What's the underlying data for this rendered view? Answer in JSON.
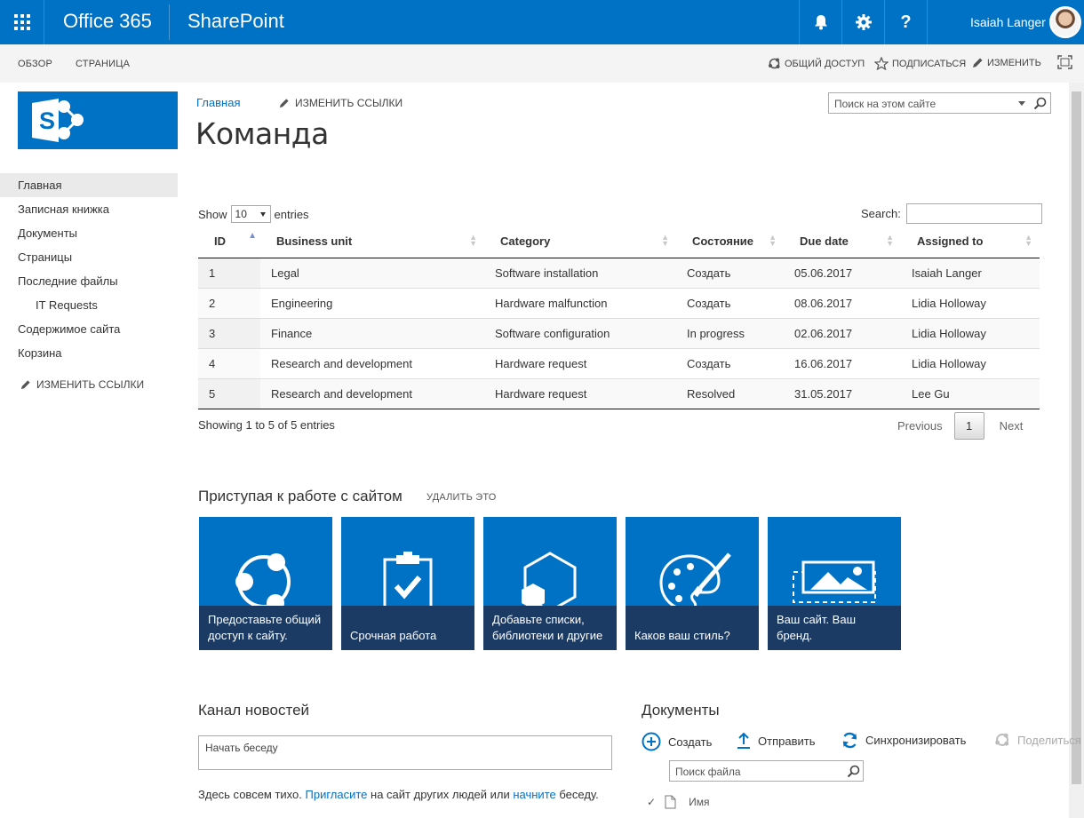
{
  "suitebar": {
    "brand": "Office 365",
    "app": "SharePoint",
    "user_name": "Isaiah Langer",
    "accent": "#0072c6"
  },
  "ribbon": {
    "tabs": [
      "ОБЗОР",
      "СТРАНИЦА"
    ],
    "share": "ОБЩИЙ ДОСТУП",
    "follow": "ПОДПИСАТЬСЯ",
    "edit": "ИЗМЕНИТЬ"
  },
  "page": {
    "breadcrumb": "Главная",
    "edit_links": "ИЗМЕНИТЬ ССЫЛКИ",
    "title": "Команда",
    "search_placeholder": "Поиск на этом сайте"
  },
  "quicklaunch": {
    "items": [
      "Главная",
      "Записная книжка",
      "Документы",
      "Страницы",
      "Последние файлы",
      "IT Requests",
      "Содержимое сайта",
      "Корзина"
    ],
    "edit_links": "ИЗМЕНИТЬ ССЫЛКИ"
  },
  "datatable": {
    "show_label": "Show",
    "length_value": "10",
    "entries_label": "entries",
    "search_label": "Search:",
    "columns": [
      "ID",
      "Business unit",
      "Category",
      "Состояние",
      "Due date",
      "Assigned to"
    ],
    "rows": [
      [
        "1",
        "Legal",
        "Software installation",
        "Создать",
        "05.06.2017",
        "Isaiah Langer"
      ],
      [
        "2",
        "Engineering",
        "Hardware malfunction",
        "Создать",
        "08.06.2017",
        "Lidia Holloway"
      ],
      [
        "3",
        "Finance",
        "Software configuration",
        "In progress",
        "02.06.2017",
        "Lidia Holloway"
      ],
      [
        "4",
        "Research and development",
        "Hardware request",
        "Создать",
        "16.06.2017",
        "Lidia Holloway"
      ],
      [
        "5",
        "Research and development",
        "Hardware request",
        "Resolved",
        "31.05.2017",
        "Lee Gu"
      ]
    ],
    "info": "Showing 1 to 5 of 5 entries",
    "prev": "Previous",
    "page": "1",
    "next": "Next"
  },
  "getting_started": {
    "title": "Приступая к работе с сайтом",
    "remove": "УДАЛИТЬ ЭТО",
    "tiles": [
      {
        "label": "Предоставьте общий доступ к сайту.",
        "icon": "share-site-icon"
      },
      {
        "label": "Срочная работа",
        "icon": "clipboard-check-icon"
      },
      {
        "label": "Добавьте списки, библиотеки и другие",
        "icon": "add-apps-icon"
      },
      {
        "label": "Каков ваш стиль?",
        "icon": "palette-icon"
      },
      {
        "label": "Ваш сайт. Ваш бренд.",
        "icon": "image-brand-icon"
      }
    ]
  },
  "newsfeed": {
    "title": "Канал новостей",
    "placeholder": "Начать беседу",
    "quiet_1": "Здесь совсем тихо. ",
    "invite": "Пригласите",
    "quiet_2": " на сайт других людей или ",
    "start": "начните",
    "quiet_3": " беседу."
  },
  "documents": {
    "title": "Документы",
    "create": "Создать",
    "upload": "Отправить",
    "sync": "Синхронизировать",
    "share": "Поделиться",
    "search_placeholder": "Поиск файла",
    "name_col": "Имя"
  }
}
